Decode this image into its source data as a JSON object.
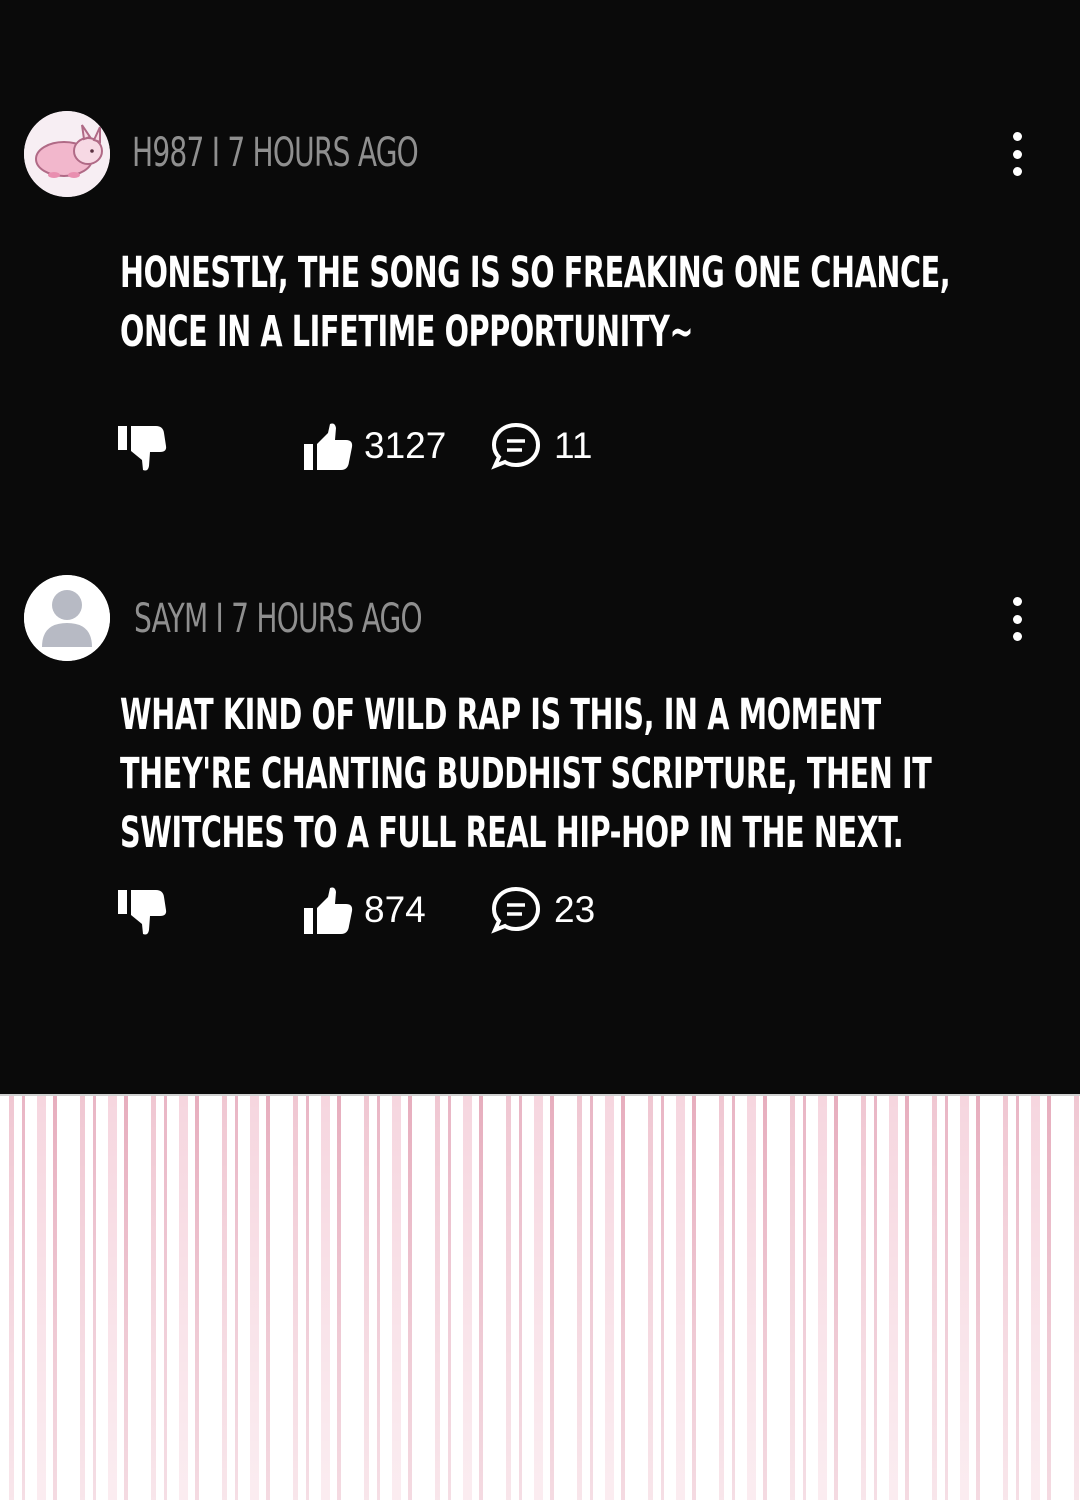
{
  "comments": [
    {
      "username": "H987",
      "separator": "I",
      "time": "7 HOURS AGO",
      "meta": "H987 I 7 HOURS AGO",
      "text": "HONESTLY, THE SONG IS SO FREAKING ONE CHANCE, ONCE IN A LIFETIME OPPORTUNITY~",
      "likes": "3127",
      "replies": "11",
      "avatar_icon": "pink-rabbit-avatar"
    },
    {
      "username": "SAYM",
      "separator": "I",
      "time": "7 HOURS AGO",
      "meta": "SAYM I 7 HOURS AGO",
      "text": "WHAT KIND OF WILD RAP IS THIS, IN A MOMENT THEY'RE CHANTING BUDDHIST SCRIPTURE, THEN IT SWITCHES TO A FULL REAL HIP-HOP IN THE NEXT.",
      "likes": "874",
      "replies": "23",
      "avatar_icon": "default-user-avatar"
    }
  ],
  "icons": {
    "dislike": "thumbs-down-icon",
    "like": "thumbs-up-icon",
    "reply": "chat-bubble-icon",
    "more": "more-vertical-icon"
  },
  "colors": {
    "background": "#0a0a0a",
    "meta_text": "#8f8f8f",
    "body_text": "#ffffff",
    "art_pink": "#f0c7d2"
  }
}
